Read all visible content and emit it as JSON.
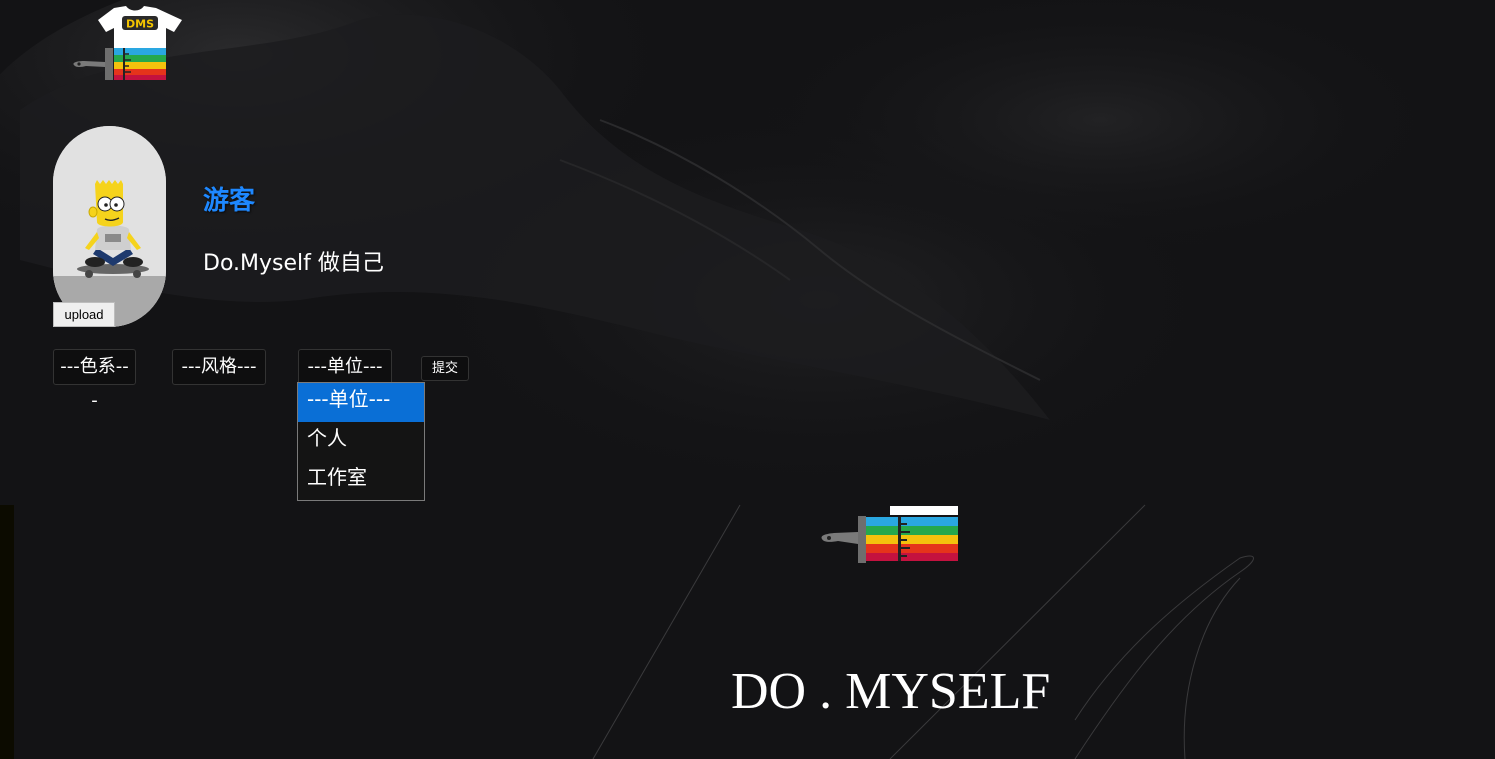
{
  "header": {
    "logo": {
      "icon": "brush-tshirt-logo-icon",
      "shirt_text": "DMS"
    }
  },
  "profile": {
    "username": "游客",
    "bio": "Do.Myself 做自己",
    "upload_label": "upload",
    "avatar_icon": "cartoon-avatar-icon"
  },
  "filters": {
    "color_select": {
      "selected": "---色系---"
    },
    "style_select": {
      "selected": "---风格---"
    },
    "unit_select": {
      "selected": "---单位---",
      "options": [
        "---单位---",
        "个人",
        "工作室"
      ]
    },
    "submit_label": "提交"
  },
  "brand": {
    "icon": "paint-brush-icon",
    "text": "DO . MYSELF"
  },
  "colors": {
    "background": "#131315",
    "username": "#1e88ff",
    "option_highlight": "#0a6fd6",
    "rainbow": [
      "#2aa7e1",
      "#25a84c",
      "#f4c20d",
      "#e5341b",
      "#c4123f"
    ]
  }
}
